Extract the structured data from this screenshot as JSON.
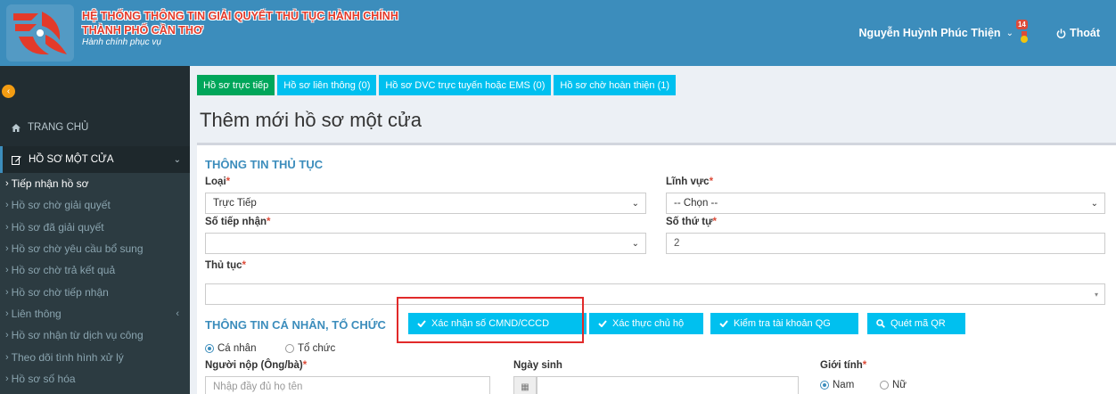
{
  "header": {
    "title_line1": "HỆ THỐNG THÔNG TIN GIẢI QUYẾT THỦ TỤC HÀNH CHÍNH",
    "title_line2": "THÀNH PHỐ CẦN THƠ",
    "subtitle": "Hành chính phục vụ",
    "user_name": "Nguyễn Huỳnh Phúc Thiện",
    "notif_count": "14",
    "logout_label": "Thoát"
  },
  "sidebar": {
    "home": "TRANG CHỦ",
    "section": "HỒ SƠ MỘT CỬA",
    "items": [
      {
        "label": "Tiếp nhận hồ sơ"
      },
      {
        "label": "Hồ sơ chờ giải quyết"
      },
      {
        "label": "Hồ sơ đã giải quyết"
      },
      {
        "label": "Hồ sơ chờ yêu cầu bổ sung"
      },
      {
        "label": "Hồ sơ chờ trả kết quả"
      },
      {
        "label": "Hồ sơ chờ tiếp nhận"
      },
      {
        "label": "Liên thông"
      },
      {
        "label": "Hồ sơ nhận từ dịch vụ công"
      },
      {
        "label": "Theo dõi tình hình xử lý"
      },
      {
        "label": "Hồ sơ số hóa"
      }
    ]
  },
  "tabs": [
    {
      "label": "Hồ sơ trực tiếp"
    },
    {
      "label": "Hồ sơ liên thông (0)"
    },
    {
      "label": "Hồ sơ DVC trực tuyến hoặc EMS (0)"
    },
    {
      "label": "Hồ sơ chờ hoàn thiện (1)"
    }
  ],
  "page_title": "Thêm mới hồ sơ một cửa",
  "form": {
    "section1": "THÔNG TIN THỦ TỤC",
    "loai_label": "Loại",
    "loai_value": "Trực Tiếp",
    "linhvuc_label": "Lĩnh vực",
    "linhvuc_value": "-- Chọn --",
    "sotiepnhan_label": "Số tiếp nhận",
    "sotiepnhan_value": "",
    "sothutu_label": "Số thứ tự",
    "sothutu_value": "2",
    "thutuc_label": "Thủ tục",
    "thutuc_value": "",
    "section2": "THÔNG TIN CÁ NHÂN, TỔ CHỨC",
    "btn_cmnd": "Xác nhận số CMND/CCCD",
    "btn_chuho": "Xác thực chủ hộ",
    "btn_taikhoan": "Kiểm tra tài khoản QG",
    "btn_qr": "Quét mã QR",
    "radio_canhan": "Cá nhân",
    "radio_tochuc": "Tổ chức",
    "nguoinop_label": "Người nộp (Ông/bà)",
    "nguoinop_placeholder": "Nhập đầy đủ họ tên",
    "ngaysinh_label": "Ngày sinh",
    "gioitinh_label": "Giới tính",
    "gioitinh_nam": "Nam",
    "gioitinh_nu": "Nữ",
    "required_mark": "*"
  },
  "colors": {
    "header": "#3c8dbc",
    "sidebar": "#222d32",
    "tab": "#00c0ef",
    "tab_active": "#00a65a",
    "highlight": "#e12a2a"
  }
}
